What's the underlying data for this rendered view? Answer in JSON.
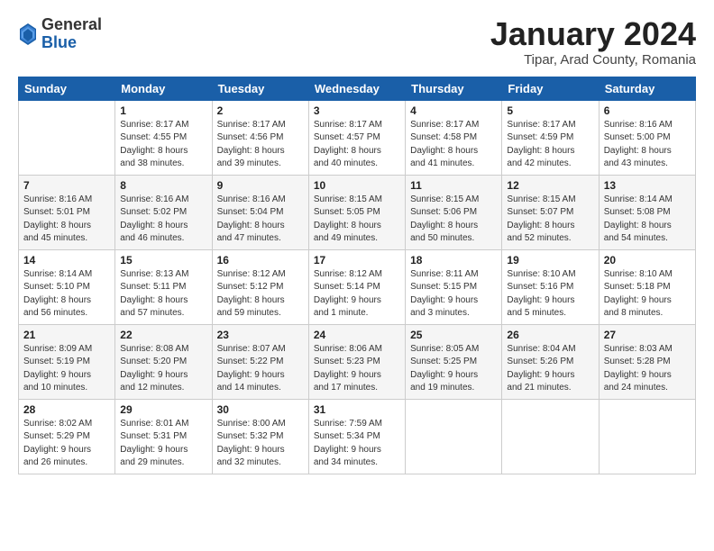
{
  "header": {
    "logo": {
      "general": "General",
      "blue": "Blue"
    },
    "title": "January 2024",
    "location": "Tipar, Arad County, Romania"
  },
  "days_of_week": [
    "Sunday",
    "Monday",
    "Tuesday",
    "Wednesday",
    "Thursday",
    "Friday",
    "Saturday"
  ],
  "weeks": [
    [
      {
        "day": "",
        "info": ""
      },
      {
        "day": "1",
        "info": "Sunrise: 8:17 AM\nSunset: 4:55 PM\nDaylight: 8 hours\nand 38 minutes."
      },
      {
        "day": "2",
        "info": "Sunrise: 8:17 AM\nSunset: 4:56 PM\nDaylight: 8 hours\nand 39 minutes."
      },
      {
        "day": "3",
        "info": "Sunrise: 8:17 AM\nSunset: 4:57 PM\nDaylight: 8 hours\nand 40 minutes."
      },
      {
        "day": "4",
        "info": "Sunrise: 8:17 AM\nSunset: 4:58 PM\nDaylight: 8 hours\nand 41 minutes."
      },
      {
        "day": "5",
        "info": "Sunrise: 8:17 AM\nSunset: 4:59 PM\nDaylight: 8 hours\nand 42 minutes."
      },
      {
        "day": "6",
        "info": "Sunrise: 8:16 AM\nSunset: 5:00 PM\nDaylight: 8 hours\nand 43 minutes."
      }
    ],
    [
      {
        "day": "7",
        "info": "Sunrise: 8:16 AM\nSunset: 5:01 PM\nDaylight: 8 hours\nand 45 minutes."
      },
      {
        "day": "8",
        "info": "Sunrise: 8:16 AM\nSunset: 5:02 PM\nDaylight: 8 hours\nand 46 minutes."
      },
      {
        "day": "9",
        "info": "Sunrise: 8:16 AM\nSunset: 5:04 PM\nDaylight: 8 hours\nand 47 minutes."
      },
      {
        "day": "10",
        "info": "Sunrise: 8:15 AM\nSunset: 5:05 PM\nDaylight: 8 hours\nand 49 minutes."
      },
      {
        "day": "11",
        "info": "Sunrise: 8:15 AM\nSunset: 5:06 PM\nDaylight: 8 hours\nand 50 minutes."
      },
      {
        "day": "12",
        "info": "Sunrise: 8:15 AM\nSunset: 5:07 PM\nDaylight: 8 hours\nand 52 minutes."
      },
      {
        "day": "13",
        "info": "Sunrise: 8:14 AM\nSunset: 5:08 PM\nDaylight: 8 hours\nand 54 minutes."
      }
    ],
    [
      {
        "day": "14",
        "info": "Sunrise: 8:14 AM\nSunset: 5:10 PM\nDaylight: 8 hours\nand 56 minutes."
      },
      {
        "day": "15",
        "info": "Sunrise: 8:13 AM\nSunset: 5:11 PM\nDaylight: 8 hours\nand 57 minutes."
      },
      {
        "day": "16",
        "info": "Sunrise: 8:12 AM\nSunset: 5:12 PM\nDaylight: 8 hours\nand 59 minutes."
      },
      {
        "day": "17",
        "info": "Sunrise: 8:12 AM\nSunset: 5:14 PM\nDaylight: 9 hours\nand 1 minute."
      },
      {
        "day": "18",
        "info": "Sunrise: 8:11 AM\nSunset: 5:15 PM\nDaylight: 9 hours\nand 3 minutes."
      },
      {
        "day": "19",
        "info": "Sunrise: 8:10 AM\nSunset: 5:16 PM\nDaylight: 9 hours\nand 5 minutes."
      },
      {
        "day": "20",
        "info": "Sunrise: 8:10 AM\nSunset: 5:18 PM\nDaylight: 9 hours\nand 8 minutes."
      }
    ],
    [
      {
        "day": "21",
        "info": "Sunrise: 8:09 AM\nSunset: 5:19 PM\nDaylight: 9 hours\nand 10 minutes."
      },
      {
        "day": "22",
        "info": "Sunrise: 8:08 AM\nSunset: 5:20 PM\nDaylight: 9 hours\nand 12 minutes."
      },
      {
        "day": "23",
        "info": "Sunrise: 8:07 AM\nSunset: 5:22 PM\nDaylight: 9 hours\nand 14 minutes."
      },
      {
        "day": "24",
        "info": "Sunrise: 8:06 AM\nSunset: 5:23 PM\nDaylight: 9 hours\nand 17 minutes."
      },
      {
        "day": "25",
        "info": "Sunrise: 8:05 AM\nSunset: 5:25 PM\nDaylight: 9 hours\nand 19 minutes."
      },
      {
        "day": "26",
        "info": "Sunrise: 8:04 AM\nSunset: 5:26 PM\nDaylight: 9 hours\nand 21 minutes."
      },
      {
        "day": "27",
        "info": "Sunrise: 8:03 AM\nSunset: 5:28 PM\nDaylight: 9 hours\nand 24 minutes."
      }
    ],
    [
      {
        "day": "28",
        "info": "Sunrise: 8:02 AM\nSunset: 5:29 PM\nDaylight: 9 hours\nand 26 minutes."
      },
      {
        "day": "29",
        "info": "Sunrise: 8:01 AM\nSunset: 5:31 PM\nDaylight: 9 hours\nand 29 minutes."
      },
      {
        "day": "30",
        "info": "Sunrise: 8:00 AM\nSunset: 5:32 PM\nDaylight: 9 hours\nand 32 minutes."
      },
      {
        "day": "31",
        "info": "Sunrise: 7:59 AM\nSunset: 5:34 PM\nDaylight: 9 hours\nand 34 minutes."
      },
      {
        "day": "",
        "info": ""
      },
      {
        "day": "",
        "info": ""
      },
      {
        "day": "",
        "info": ""
      }
    ]
  ]
}
